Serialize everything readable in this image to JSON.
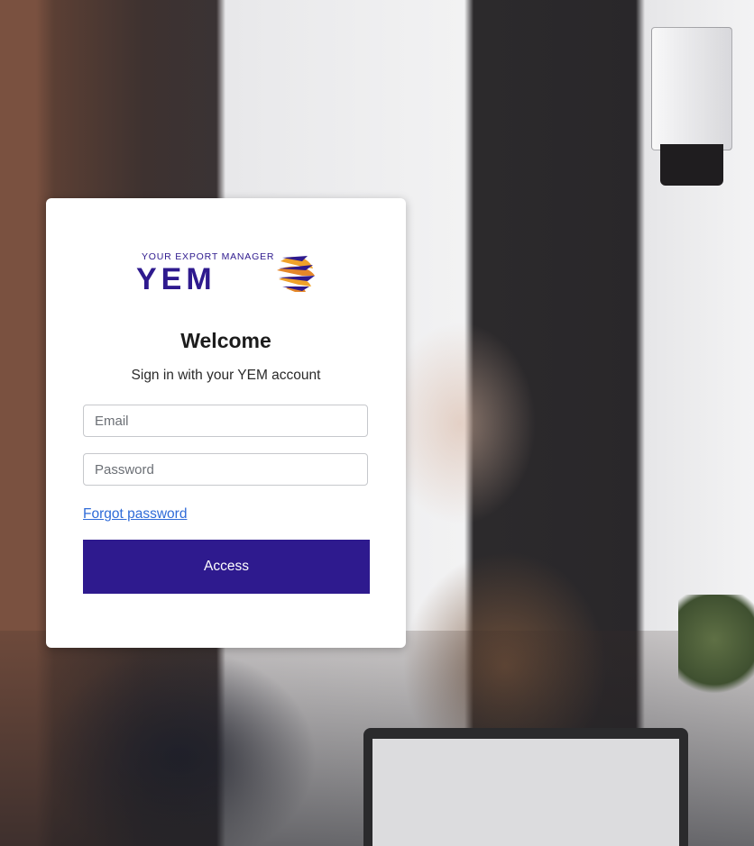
{
  "brand": {
    "tagline": "YOUR EXPORT MANAGER",
    "name": "YEM",
    "primary_color": "#2e1a8e",
    "accent_color": "#f0a22a"
  },
  "login": {
    "title": "Welcome",
    "subtitle": "Sign in with your YEM account",
    "email_placeholder": "Email",
    "password_placeholder": "Password",
    "forgot_link": "Forgot password",
    "submit_label": "Access"
  }
}
